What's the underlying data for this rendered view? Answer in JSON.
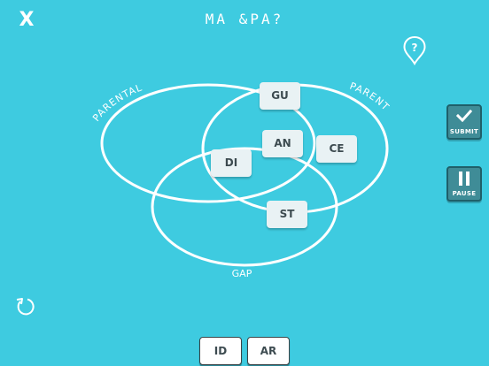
{
  "header": {
    "close_label": "X",
    "title": "MA &PA?"
  },
  "diagram": {
    "circles": [
      {
        "label": "PARENTAL"
      },
      {
        "label": "PARENT"
      },
      {
        "label": "GAP"
      }
    ],
    "tiles_placed": [
      "GU",
      "AN",
      "CE",
      "DI",
      "ST"
    ]
  },
  "tray": {
    "tiles": [
      "ID",
      "AR"
    ]
  },
  "buttons": {
    "submit_label": "SUBMIT",
    "pause_label": "PAUSE"
  },
  "icons": {
    "close": "close-icon",
    "help": "help-pin-icon",
    "submit": "checkmark-icon",
    "pause": "pause-icon",
    "reset": "undo-arrow-icon"
  },
  "colors": {
    "background": "#3ecbe0",
    "circle_stroke": "#ffffff",
    "tile": "#e9f2f4",
    "button": "#3f8c97"
  }
}
